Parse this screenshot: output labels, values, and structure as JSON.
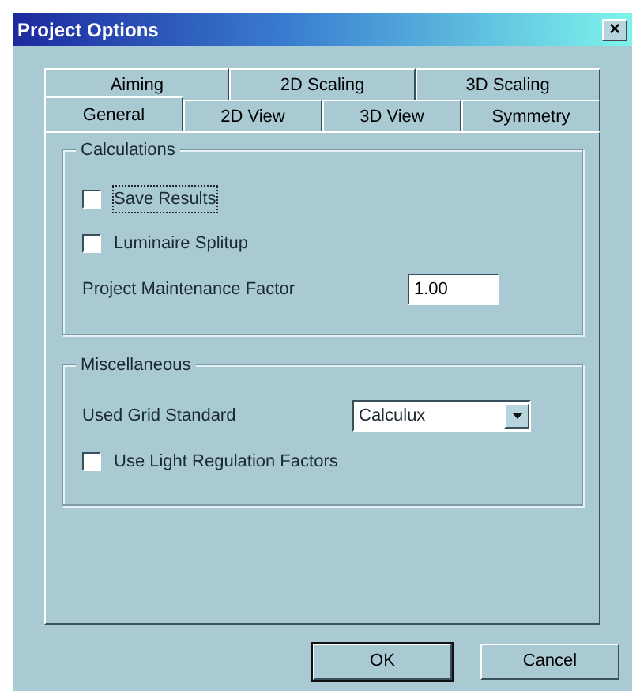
{
  "window": {
    "title": "Project Options",
    "close": "×"
  },
  "tab_rows": [
    [
      {
        "label": "Aiming",
        "selected": false
      },
      {
        "label": "2D Scaling",
        "selected": false
      },
      {
        "label": "3D Scaling",
        "selected": false
      }
    ],
    [
      {
        "label": "General",
        "selected": true
      },
      {
        "label": "2D View",
        "selected": false
      },
      {
        "label": "3D View",
        "selected": false
      },
      {
        "label": "Symmetry",
        "selected": false
      }
    ]
  ],
  "groups": [
    {
      "title": "Calculations",
      "items": [
        {
          "kind": "checkbox",
          "label": "Save Results",
          "checked": false,
          "focused": true
        },
        {
          "kind": "checkbox",
          "label": "Luminaire Splitup",
          "checked": false,
          "focused": false
        },
        {
          "kind": "textfield",
          "label": "Project Maintenance Factor",
          "value": "1.00"
        }
      ]
    },
    {
      "title": "Miscellaneous",
      "items": [
        {
          "kind": "select",
          "label": "Used Grid Standard",
          "value": "Calculux"
        },
        {
          "kind": "checkbox",
          "label": "Use Light Regulation Factors",
          "checked": false,
          "focused": false
        }
      ]
    }
  ],
  "buttons": [
    {
      "label": "OK",
      "default": true
    },
    {
      "label": "Cancel",
      "default": false
    }
  ]
}
